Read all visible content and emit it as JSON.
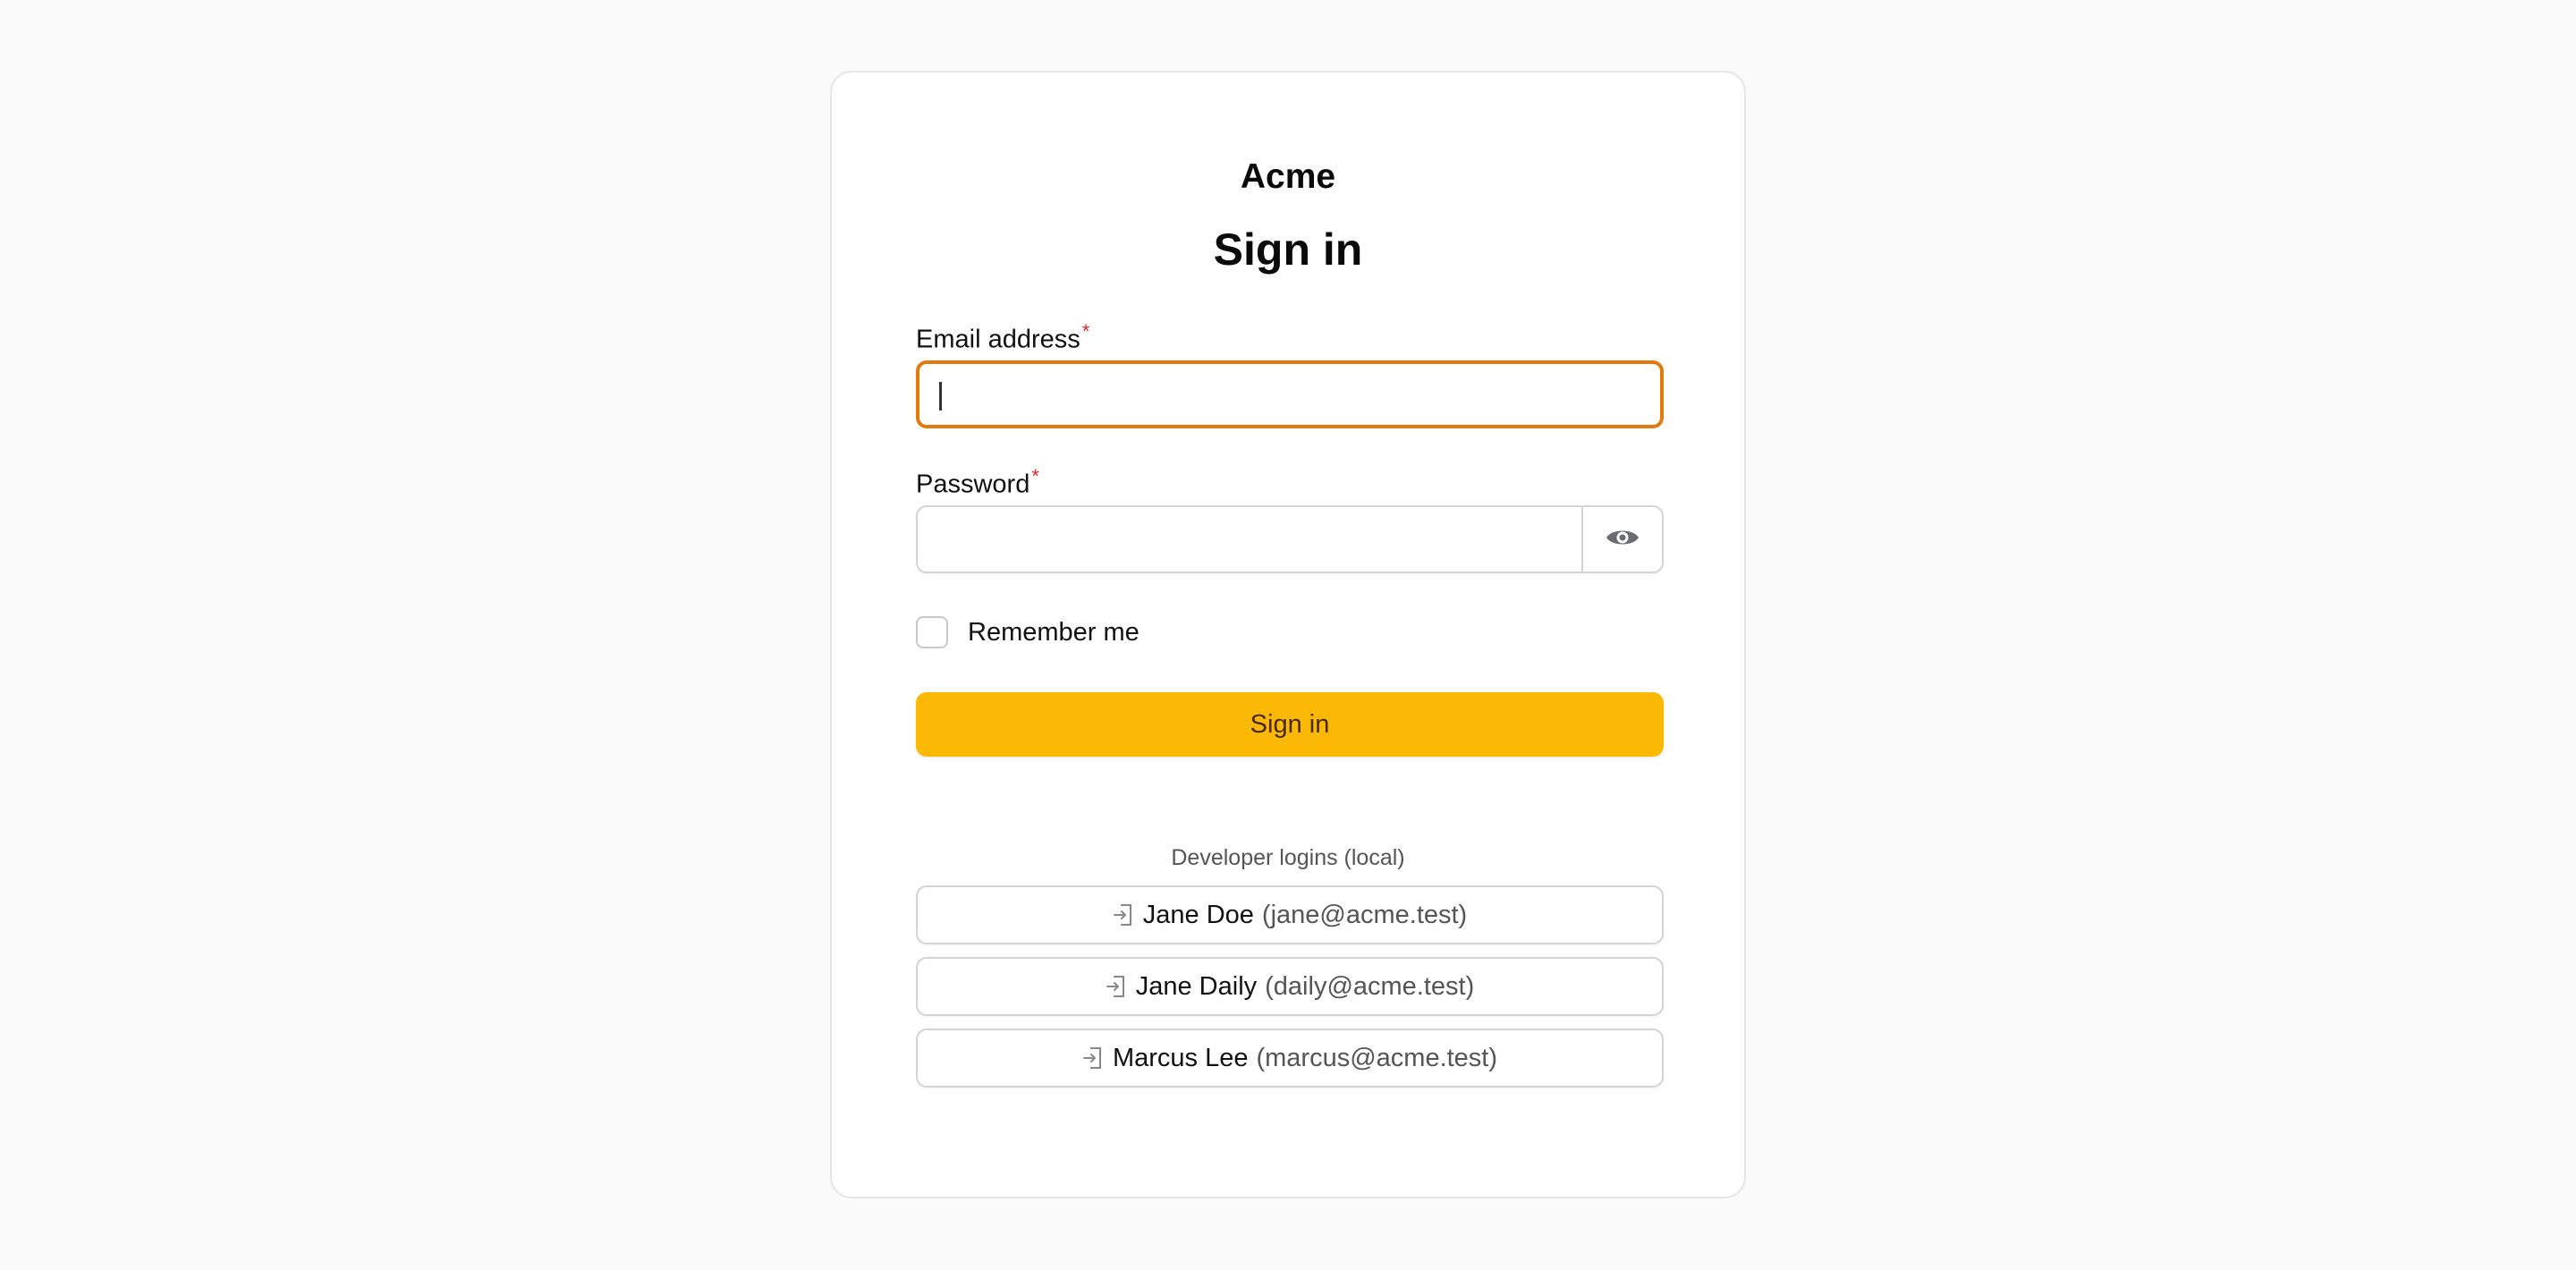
{
  "brand": "Acme",
  "title": "Sign in",
  "email": {
    "label": "Email address",
    "required_marker": "*",
    "value": ""
  },
  "password": {
    "label": "Password",
    "required_marker": "*",
    "value": "",
    "toggle_icon": "eye-icon"
  },
  "remember": {
    "label": "Remember me",
    "checked": false
  },
  "submit_label": "Sign in",
  "developer": {
    "heading": "Developer logins (local)",
    "logins": [
      {
        "name": "Jane Doe",
        "email": "(jane@acme.test)"
      },
      {
        "name": "Jane Daily",
        "email": "(daily@acme.test)"
      },
      {
        "name": "Marcus Lee",
        "email": "(marcus@acme.test)"
      }
    ],
    "icon": "login-icon"
  },
  "colors": {
    "background": "#fafafa",
    "focus_border": "#e27a0f",
    "primary_button": "#fbb905",
    "required": "#e02424"
  }
}
